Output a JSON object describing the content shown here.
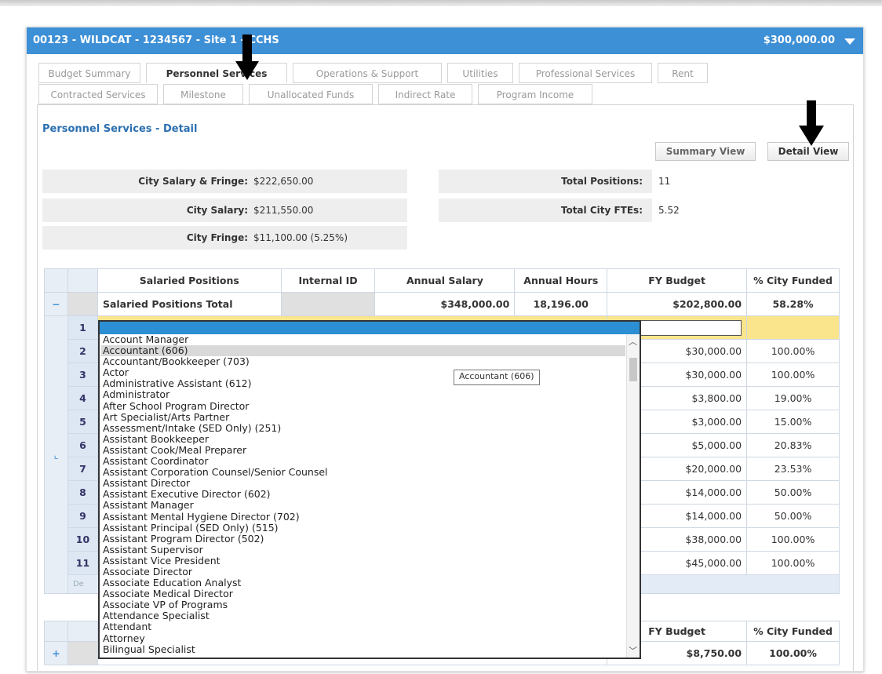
{
  "header": {
    "title": "00123 - WILDCAT - 1234567 - Site 1 - CCHS",
    "amount": "$300,000.00"
  },
  "tabs": {
    "row1": [
      "Budget Summary",
      "Personnel Services",
      "Operations & Support",
      "Utilities",
      "Professional Services",
      "Rent"
    ],
    "row2": [
      "Contracted Services",
      "Milestone",
      "Unallocated Funds",
      "Indirect Rate",
      "Program Income"
    ]
  },
  "section": {
    "title": "Personnel Services - Detail",
    "summary_view": "Summary View",
    "detail_view": "Detail View"
  },
  "summary": {
    "city_salary_fringe_label": "City Salary & Fringe:",
    "city_salary_fringe_value": "$222,650.00",
    "city_salary_label": "City Salary:",
    "city_salary_value": "$211,550.00",
    "city_fringe_label": "City Fringe:",
    "city_fringe_value": "$11,100.00 (5.25%)",
    "total_positions_label": "Total Positions:",
    "total_positions_value": "11",
    "total_fte_label": "Total City FTEs:",
    "total_fte_value": "5.52"
  },
  "grid": {
    "headers": [
      "Salaried Positions",
      "Internal ID",
      "Annual Salary",
      "Annual Hours",
      "FY Budget",
      "% City Funded"
    ],
    "total": {
      "expander": "−",
      "label": "Salaried Positions Total",
      "annual_salary": "$348,000.00",
      "annual_hours": "18,196.00",
      "fy_budget": "$202,800.00",
      "city_funded": "58.28%"
    },
    "rows": [
      {
        "num": "1",
        "fy_budget": "",
        "city_funded": ""
      },
      {
        "num": "2",
        "fy_budget": "$30,000.00",
        "city_funded": "100.00%"
      },
      {
        "num": "3",
        "fy_budget": "$30,000.00",
        "city_funded": "100.00%"
      },
      {
        "num": "4",
        "fy_budget": "$3,800.00",
        "city_funded": "19.00%"
      },
      {
        "num": "5",
        "fy_budget": "$3,000.00",
        "city_funded": "15.00%"
      },
      {
        "num": "6",
        "fy_budget": "$5,000.00",
        "city_funded": "20.83%"
      },
      {
        "num": "7",
        "fy_budget": "$20,000.00",
        "city_funded": "23.53%"
      },
      {
        "num": "8",
        "fy_budget": "$14,000.00",
        "city_funded": "50.00%"
      },
      {
        "num": "9",
        "fy_budget": "$14,000.00",
        "city_funded": "50.00%"
      },
      {
        "num": "10",
        "fy_budget": "$38,000.00",
        "city_funded": "100.00%"
      },
      {
        "num": "11",
        "fy_budget": "$45,000.00",
        "city_funded": "100.00%"
      }
    ],
    "footer_hint": "De"
  },
  "grid2": {
    "fy_budget_header": "FY Budget",
    "city_funded_header": "% City Funded",
    "expander": "+",
    "fy_budget": "$8,750.00",
    "city_funded": "100.00%"
  },
  "dropdown": {
    "options": [
      "Account Manager",
      "Accountant (606)",
      "Accountant/Bookkeeper (703)",
      "Actor",
      "Administrative Assistant (612)",
      "Administrator",
      "After School Program Director",
      "Art Specialist/Arts Partner",
      "Assessment/Intake (SED Only) (251)",
      "Assistant Bookkeeper",
      "Assistant Cook/Meal Preparer",
      "Assistant Coordinator",
      "Assistant Corporation Counsel/Senior Counsel",
      "Assistant Director",
      "Assistant Executive Director (602)",
      "Assistant Manager",
      "Assistant Mental Hygiene Director (702)",
      "Assistant Principal (SED Only) (515)",
      "Assistant Program Director (502)",
      "Assistant Supervisor",
      "Assistant Vice President",
      "Associate Director",
      "Associate Education Analyst",
      "Associate Medical Director",
      "Associate VP of Programs",
      "Attendance Specialist",
      "Attendant",
      "Attorney",
      "Bilingual Specialist"
    ],
    "selected_index": 1,
    "tooltip": "Accountant (606)"
  }
}
